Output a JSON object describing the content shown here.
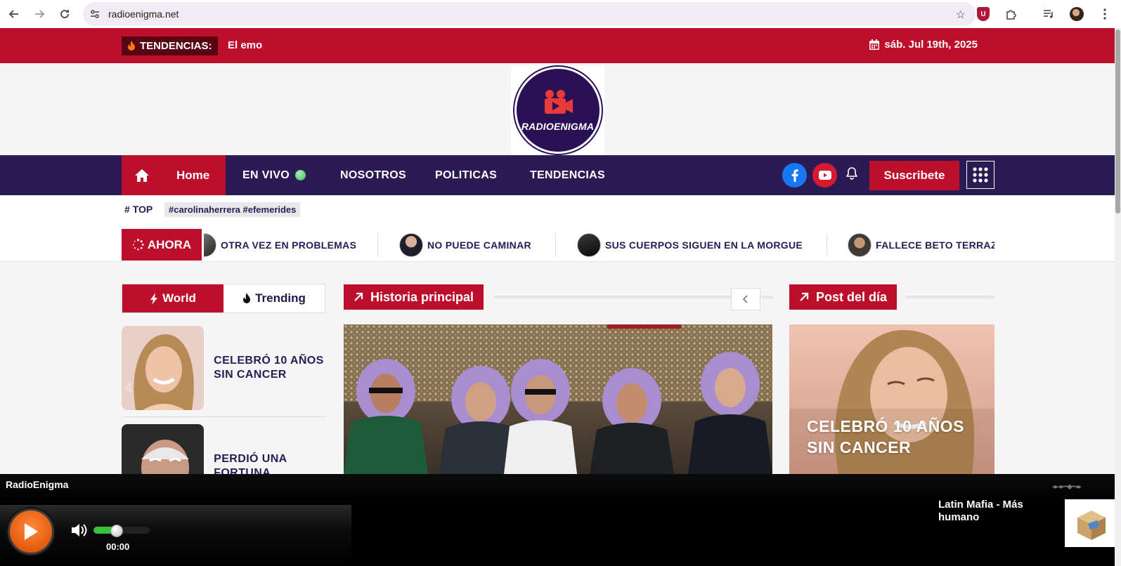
{
  "browser": {
    "url": "radioenigma.net"
  },
  "topbar": {
    "trending_label": "TENDENCIAS:",
    "trending_text": "El emo",
    "date": "sáb. Jul 19th, 2025"
  },
  "logo": {
    "text": "RADIOENIGMA"
  },
  "nav": {
    "home": "Home",
    "items": [
      "EN VIVO",
      "NOSOTROS",
      "POLITICAS",
      "TENDENCIAS"
    ],
    "subscribe": "Suscribete"
  },
  "tags": {
    "label": "TOP",
    "chips": "#carolinaherrera #efemerides"
  },
  "ticker": {
    "label": "AHORA",
    "items": [
      "OTRA VEZ EN PROBLEMAS",
      "NO PUEDE CAMINAR",
      "SUS CUERPOS SIGUEN EN LA MORGUE",
      "FALLECE BETO TERRAZ"
    ]
  },
  "tabs": {
    "world": "World",
    "trending": "Trending"
  },
  "sidebar": {
    "items": [
      {
        "title": "CELEBRÓ 10 AÑOS SIN CANCER"
      },
      {
        "title": "PERDIÓ UNA FORTUNA"
      }
    ]
  },
  "sections": {
    "main": "Historia principal",
    "post": "Post del día"
  },
  "post": {
    "title": "CELEBRÓ 10 AÑOS SIN CANCER"
  },
  "player": {
    "station": "RadioEnigma",
    "time": "00:00",
    "volume_percent": 42,
    "track": "Latin Mafia - Más humano"
  },
  "colors": {
    "brand_red": "#bd0f2b",
    "nav_purple": "#2a1b55",
    "live_green": "#38b85a",
    "facebook": "#1877f2",
    "youtube": "#d8192f"
  }
}
